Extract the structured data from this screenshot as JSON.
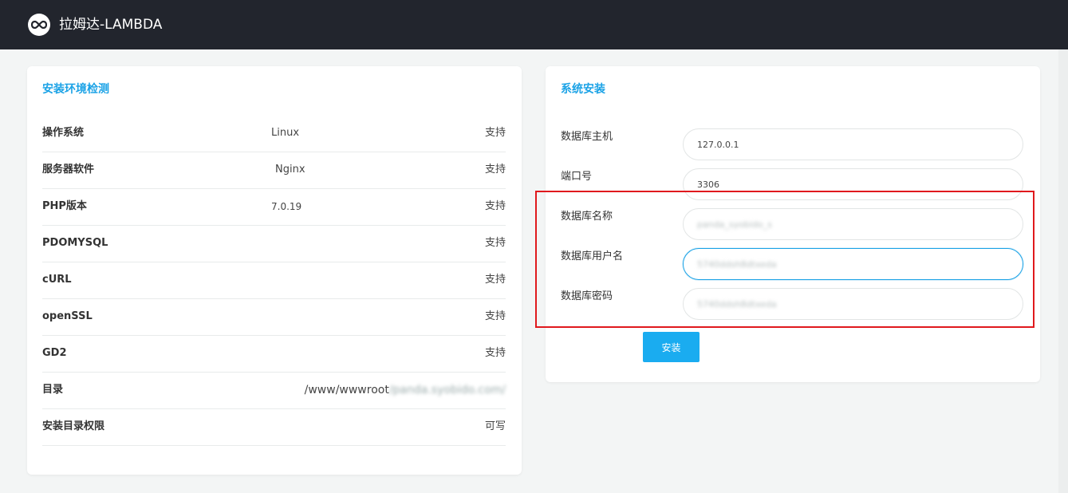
{
  "app": {
    "title": "拉姆达-LAMBDA"
  },
  "env_check": {
    "title": "安装环境检测",
    "rows": [
      {
        "name": "操作系统",
        "value": "Linux",
        "status": "支持"
      },
      {
        "name": "服务器软件",
        "value": "Nginx",
        "status": "支持"
      },
      {
        "name": "PHP版本",
        "value": "7.0.19",
        "status": "支持"
      },
      {
        "name": "PDOMYSQL",
        "value": "",
        "status": "支持"
      },
      {
        "name": "cURL",
        "value": "",
        "status": "支持"
      },
      {
        "name": "openSSL",
        "value": "",
        "status": "支持"
      },
      {
        "name": "GD2",
        "value": "",
        "status": "支持"
      },
      {
        "name": "目录",
        "value": "/www/wwwroot",
        "value_blurred": "/panda.syobido.com/",
        "status": ""
      },
      {
        "name": "安装目录权限",
        "value": "",
        "status": "可写"
      }
    ]
  },
  "install": {
    "title": "系统安装",
    "fields": [
      {
        "label": "数据库主机",
        "value": "127.0.0.1"
      },
      {
        "label": "端口号",
        "value": "3306"
      },
      {
        "label": "数据库名称",
        "value": "panda_syobido_s"
      },
      {
        "label": "数据库用户名",
        "value": "5740ddsh8dtxeda"
      },
      {
        "label": "数据库密码",
        "value": "5740ddsh8dtxeda"
      }
    ],
    "button_label": "安装"
  },
  "colors": {
    "accent": "#1aa2e6",
    "topbar": "#22252d",
    "highlight": "#e0191d",
    "button": "#1aacf0"
  }
}
